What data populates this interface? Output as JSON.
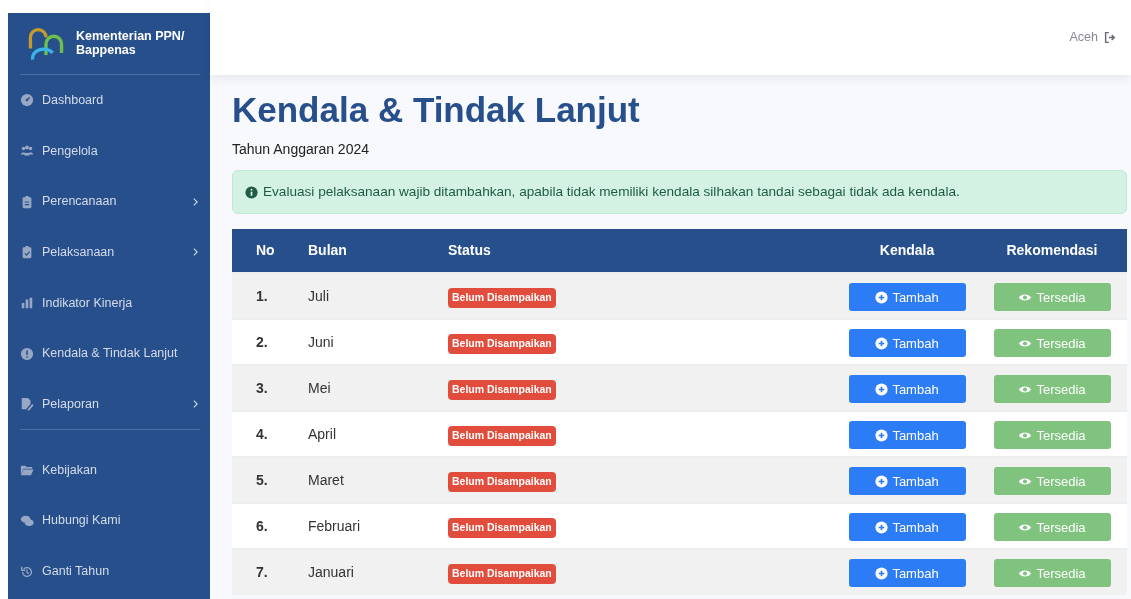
{
  "sidebar": {
    "brand": "Kementerian PPN/ Bappenas",
    "items": [
      {
        "label": "Dashboard",
        "has_submenu": false,
        "divider_after": false
      },
      {
        "label": "Pengelola",
        "has_submenu": false,
        "divider_after": false
      },
      {
        "label": "Perencanaan",
        "has_submenu": true,
        "divider_after": false
      },
      {
        "label": "Pelaksanaan",
        "has_submenu": true,
        "divider_after": false
      },
      {
        "label": "Indikator Kinerja",
        "has_submenu": false,
        "divider_after": false
      },
      {
        "label": "Kendala & Tindak Lanjut",
        "has_submenu": false,
        "divider_after": false
      },
      {
        "label": "Pelaporan",
        "has_submenu": true,
        "divider_after": true
      },
      {
        "label": "Kebijakan",
        "has_submenu": false,
        "divider_after": false
      },
      {
        "label": "Hubungi Kami",
        "has_submenu": false,
        "divider_after": false
      },
      {
        "label": "Ganti Tahun",
        "has_submenu": false,
        "divider_after": false
      }
    ]
  },
  "topbar": {
    "user": "Aceh"
  },
  "page": {
    "title": "Kendala & Tindak Lanjut",
    "subtitle": "Tahun Anggaran 2024",
    "alert": "Evaluasi pelaksanaan wajib ditambahkan, apabila tidak memiliki kendala silhakan tandai sebagai tidak ada kendala."
  },
  "table": {
    "columns": [
      "No",
      "Bulan",
      "Status",
      "Kendala",
      "Rekomendasi"
    ],
    "rows": [
      {
        "no": "1.",
        "month": "Juli",
        "status": "Belum Disampaikan",
        "kendala": "Tambah",
        "rekomendasi": "Tersedia",
        "rekomendasi_disabled": true
      },
      {
        "no": "2.",
        "month": "Juni",
        "status": "Belum Disampaikan",
        "kendala": "Tambah",
        "rekomendasi": "Tersedia",
        "rekomendasi_disabled": true
      },
      {
        "no": "3.",
        "month": "Mei",
        "status": "Belum Disampaikan",
        "kendala": "Tambah",
        "rekomendasi": "Tersedia",
        "rekomendasi_disabled": true
      },
      {
        "no": "4.",
        "month": "April",
        "status": "Belum Disampaikan",
        "kendala": "Tambah",
        "rekomendasi": "Tersedia",
        "rekomendasi_disabled": true
      },
      {
        "no": "5.",
        "month": "Maret",
        "status": "Belum Disampaikan",
        "kendala": "Tambah",
        "rekomendasi": "Tersedia",
        "rekomendasi_disabled": true
      },
      {
        "no": "6.",
        "month": "Februari",
        "status": "Belum Disampaikan",
        "kendala": "Tambah",
        "rekomendasi": "Tersedia",
        "rekomendasi_disabled": true
      },
      {
        "no": "7.",
        "month": "Januari",
        "status": "Belum Disampaikan",
        "kendala": "Tambah",
        "rekomendasi": "Tersedia",
        "rekomendasi_disabled": true
      }
    ]
  }
}
